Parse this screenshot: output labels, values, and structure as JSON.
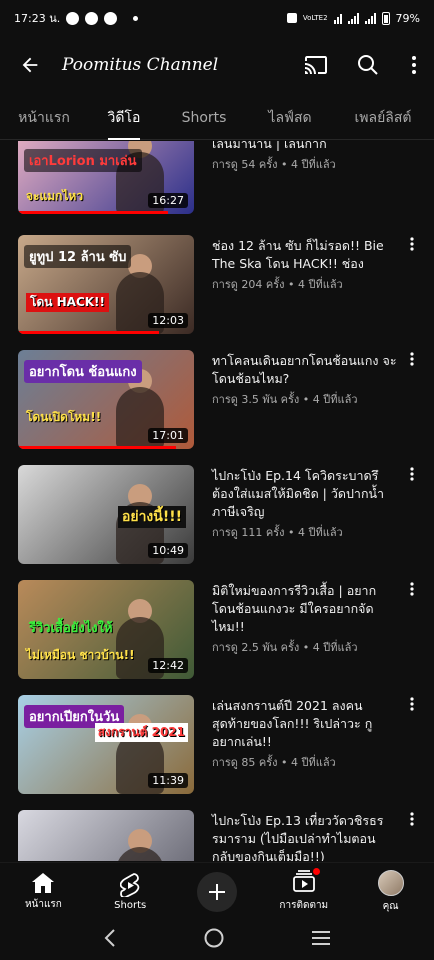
{
  "status_bar": {
    "time": "17:23 น.",
    "network": "VoLTE2",
    "battery": "79%"
  },
  "app_bar": {
    "title": "Poomitus Channel",
    "icons": [
      "back-arrow-icon",
      "cast-icon",
      "search-icon",
      "more-vert-icon"
    ]
  },
  "tabs": [
    {
      "label": "หน้าแรก",
      "active": false
    },
    {
      "label": "วิดีโอ",
      "active": true
    },
    {
      "label": "Shorts",
      "active": false
    },
    {
      "label": "ไลฟ์สด",
      "active": false
    },
    {
      "label": "เพลย์ลิสต์",
      "active": false
    }
  ],
  "videos": [
    {
      "title": "แข่งเพื่อให้ได้เห็นหลิงหาเป็นเกิดเล่นมานาน | เล่นกาก",
      "meta": "การดู 54 ครั้ง • 4 ปีที่แล้ว",
      "duration": "16:27",
      "thumb_caption": "เอาLorion มาเล่น",
      "thumb_caption2": "จะแมกไหว",
      "progress": 0.85,
      "bg": [
        "#f2b8c6",
        "#2b2f8a"
      ]
    },
    {
      "title": "ช่อง 12 ล้าน ซับ ก็ไม่รอด!! Bie The Ska โดน HACK!! ช่อง",
      "meta": "การดู 204 ครั้ง • 4 ปีที่แล้ว",
      "duration": "12:03",
      "thumb_caption": "ยูทูป 12 ล้าน ซับ",
      "thumb_caption2": "โดน HACK!!",
      "progress": 0.8,
      "bg": [
        "#c8a98a",
        "#3b2a24"
      ]
    },
    {
      "title": "ทาโคลนเดินอยากโดนช้อนแกง จะโดนช้อนไหม?",
      "meta": "การดู 3.5 พัน ครั้ง • 4 ปีที่แล้ว",
      "duration": "17:01",
      "thumb_caption": "อยากโดน ช้อนแกง",
      "thumb_caption2": "โดนเปิดโหม!!",
      "progress": 0.9,
      "bg": [
        "#6c7f96",
        "#b05a3a"
      ]
    },
    {
      "title": "ไปกะโป่ง Ep.14 โควิดระบาดรึ ต้องใส่แมสให้มิดชิด | วัดปากน้ำ ภาษีเจริญ",
      "meta": "การดู 111 ครั้ง • 4 ปีที่แล้ว",
      "duration": "10:49",
      "thumb_caption": "",
      "thumb_caption2": "อย่างนี้!!!",
      "progress": 0.0,
      "bg": [
        "#d9d9d9",
        "#3a3a3a"
      ]
    },
    {
      "title": "มิติใหม่ของการรีวิวเสื้อ | อยากโดนช้อนแกงวะ มีใครอยากจัดไหม!!",
      "meta": "การดู 2.5 พัน ครั้ง • 4 ปีที่แล้ว",
      "duration": "12:42",
      "thumb_caption": "รีวิวเสื้อยังไงให้",
      "thumb_caption2": "ไม่เหมือน ชาวบ้าน!!",
      "progress": 0.0,
      "bg": [
        "#b98a5a",
        "#3f5a36"
      ]
    },
    {
      "title": "เล่นสงกรานต์ปี 2021 ลงคน สุดท้ายของโลก!!! ริเปล่าวะ กู อยากเล่น!!",
      "meta": "การดู 85 ครั้ง • 4 ปีที่แล้ว",
      "duration": "11:39",
      "thumb_caption": "อยากเปียกในวัน",
      "thumb_caption2": "สงกรานต์ 2021",
      "progress": 0.0,
      "bg": [
        "#a8d0e6",
        "#8a6a3a"
      ]
    },
    {
      "title": "ไปกะโป่ง Ep.13 เที่ยววัดวชิรธรรมาราม (ไปมือเปล่าทำไมตอนกลับของกินเต็มมือ!!)",
      "meta": "",
      "duration": "",
      "thumb_caption": "",
      "thumb_caption2": "",
      "progress": 0.0,
      "bg": [
        "#d8d8e0",
        "#5a5a66"
      ]
    }
  ],
  "bottom_nav": [
    {
      "label": "หน้าแรก",
      "icon": "home-icon"
    },
    {
      "label": "Shorts",
      "icon": "shorts-icon"
    },
    {
      "label": "",
      "icon": "create-plus-icon"
    },
    {
      "label": "การติดตาม",
      "icon": "subscriptions-icon"
    },
    {
      "label": "คุณ",
      "icon": "avatar"
    }
  ],
  "system_nav": [
    "back-chevron-icon",
    "home-circle-icon",
    "recents-icon"
  ],
  "colors": {
    "background": "#0f0f0f",
    "accent_red": "#ff0000",
    "text_primary": "#f1f1f1",
    "text_secondary": "#aaaaaa"
  }
}
